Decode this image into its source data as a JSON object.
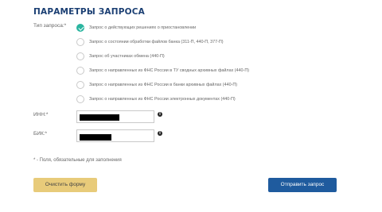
{
  "form": {
    "title": "ПАРАМЕТРЫ ЗАПРОСА",
    "request_type_label": "Тип запроса:*",
    "request_types": [
      {
        "label": "Запрос о действующих решениях о приостановлении",
        "selected": true
      },
      {
        "label": "Запрос о состоянии обработки файлов банка (311-П, 440-П, 377-П)",
        "selected": false
      },
      {
        "label": "Запрос об участниках обмена (440-П)",
        "selected": false
      },
      {
        "label": "Запрос о направленных из ФНС России в ТУ сводных архивных файлах (440-П)",
        "selected": false
      },
      {
        "label": "Запрос о направленных из ФНС России в банки архивных файлах (440-П)",
        "selected": false
      },
      {
        "label": "Запрос о направленных из ФНС России электронных документах (440-П)",
        "selected": false
      }
    ],
    "inn_label": "ИНН:*",
    "bik_label": "БИК:*",
    "info_glyph": "i",
    "required_note": "* - Поля, обязательные для заполнения",
    "clear_button": "Очистить форму",
    "submit_button": "Отправить запрос"
  },
  "icons": {
    "info": "info-icon",
    "radio_checked": "check-icon"
  },
  "colors": {
    "title": "#1b3f73",
    "accent_radio": "#2bb5a0",
    "clear_button": "#e8cb7a",
    "submit_button": "#1f5b9e"
  }
}
